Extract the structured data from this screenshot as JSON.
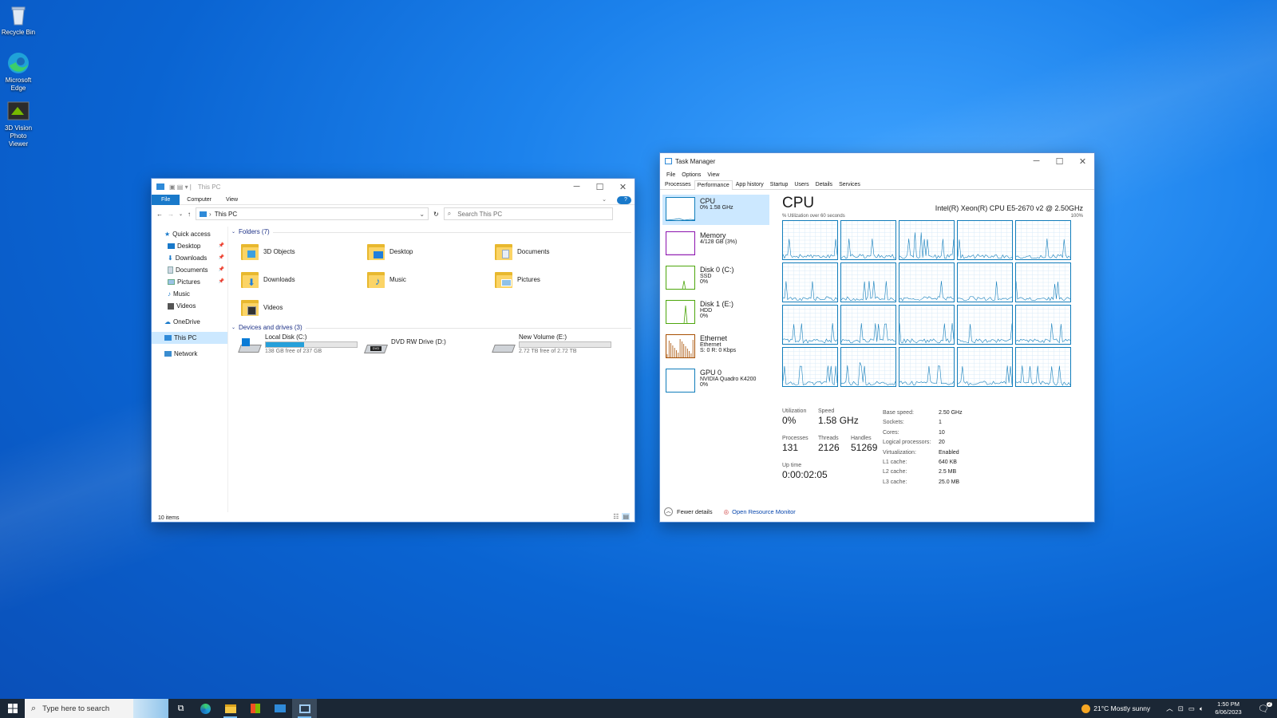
{
  "desktop": {
    "icons": [
      {
        "label": "Recycle Bin",
        "icon": "recycle-bin-icon"
      },
      {
        "label": "Microsoft Edge",
        "icon": "edge-icon"
      },
      {
        "label": "3D Vision Photo Viewer",
        "icon": "3d-vision-icon"
      }
    ]
  },
  "explorer": {
    "title": "This PC",
    "ribbon_tabs": [
      "File",
      "Computer",
      "View"
    ],
    "address": "This PC",
    "search_placeholder": "Search This PC",
    "nav": {
      "quick_access": "Quick access",
      "items": [
        "Desktop",
        "Downloads",
        "Documents",
        "Pictures",
        "Music",
        "Videos"
      ],
      "onedrive": "OneDrive",
      "this_pc": "This PC",
      "network": "Network"
    },
    "folders_header": "Folders (7)",
    "folders": [
      "3D Objects",
      "Desktop",
      "Documents",
      "Downloads",
      "Music",
      "Pictures",
      "Videos"
    ],
    "drives_header": "Devices and drives (3)",
    "drives": [
      {
        "name": "Local Disk (C:)",
        "free": "138 GB free of 237 GB",
        "used_fraction": 0.42
      },
      {
        "name": "DVD RW Drive (D:)"
      },
      {
        "name": "New Volume (E:)",
        "free": "2.72 TB free of 2.72 TB",
        "used_fraction": 0.0
      }
    ],
    "status": "10 items"
  },
  "taskmgr": {
    "title": "Task Manager",
    "menu": [
      "File",
      "Options",
      "View"
    ],
    "tabs": [
      "Processes",
      "Performance",
      "App history",
      "Startup",
      "Users",
      "Details",
      "Services"
    ],
    "resources": [
      {
        "name": "CPU",
        "sub1": "0% 1.58 GHz",
        "sub2": "",
        "color": "#117dbb"
      },
      {
        "name": "Memory",
        "sub1": "4/128 GB (3%)",
        "sub2": "",
        "color": "#8b12ae"
      },
      {
        "name": "Disk 0 (C:)",
        "sub1": "SSD",
        "sub2": "0%",
        "color": "#4da60c"
      },
      {
        "name": "Disk 1 (E:)",
        "sub1": "HDD",
        "sub2": "0%",
        "color": "#4da60c"
      },
      {
        "name": "Ethernet",
        "sub1": "Ethernet",
        "sub2": "S: 0 R: 0 Kbps",
        "color": "#a74f01"
      },
      {
        "name": "GPU 0",
        "sub1": "NVIDIA Quadro K4200",
        "sub2": "0%",
        "color": "#117dbb"
      }
    ],
    "cpu_title": "CPU",
    "cpu_model": "Intel(R) Xeon(R) CPU E5-2670 v2 @ 2.50GHz",
    "util_label": "% Utilization over 60 seconds",
    "util_max": "100%",
    "stats": {
      "utilization_label": "Utilization",
      "utilization": "0%",
      "speed_label": "Speed",
      "speed": "1.58 GHz",
      "processes_label": "Processes",
      "processes": "131",
      "threads_label": "Threads",
      "threads": "2126",
      "handles_label": "Handles",
      "handles": "51269",
      "uptime_label": "Up time",
      "uptime": "0:00:02:05"
    },
    "details": [
      {
        "k": "Base speed:",
        "v": "2.50 GHz"
      },
      {
        "k": "Sockets:",
        "v": "1"
      },
      {
        "k": "Cores:",
        "v": "10"
      },
      {
        "k": "Logical processors:",
        "v": "20"
      },
      {
        "k": "Virtualization:",
        "v": "Enabled"
      },
      {
        "k": "L1 cache:",
        "v": "640 KB"
      },
      {
        "k": "L2 cache:",
        "v": "2.5 MB"
      },
      {
        "k": "L3 cache:",
        "v": "25.0 MB"
      }
    ],
    "fewer_details": "Fewer details",
    "resource_monitor": "Open Resource Monitor"
  },
  "taskbar": {
    "search_placeholder": "Type here to search",
    "weather": "21°C  Mostly sunny",
    "time": "1:50 PM",
    "date": "6/06/2023",
    "notification_count": "2"
  }
}
